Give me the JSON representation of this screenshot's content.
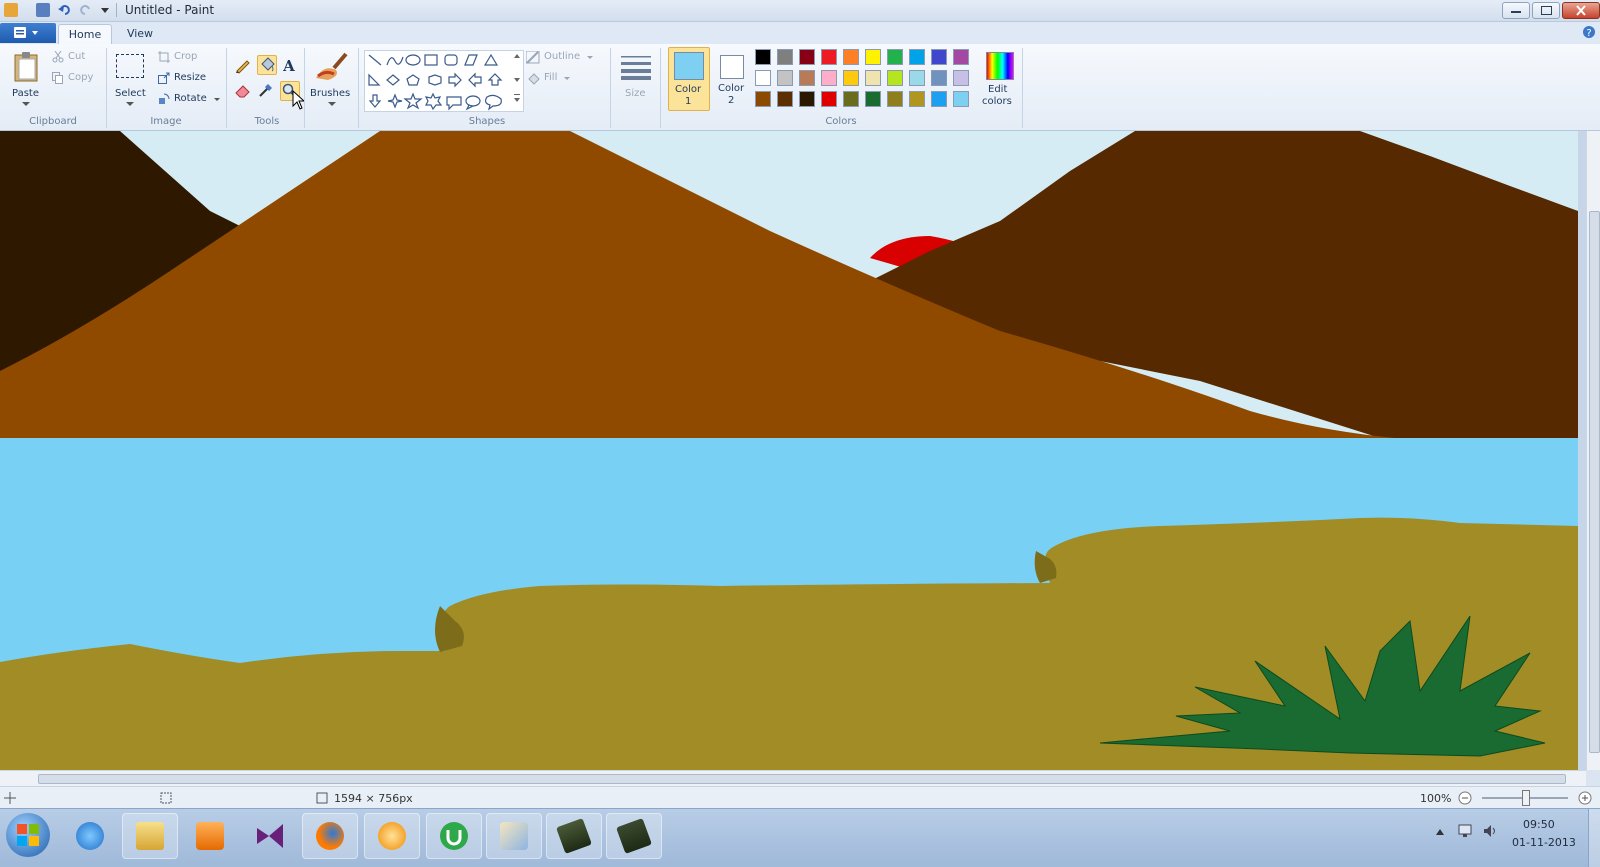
{
  "window": {
    "title": "Untitled - Paint"
  },
  "tabs": {
    "home": "Home",
    "view": "View"
  },
  "clipboard": {
    "paste": "Paste",
    "cut": "Cut",
    "copy": "Copy",
    "group": "Clipboard"
  },
  "image": {
    "select": "Select",
    "crop": "Crop",
    "resize": "Resize",
    "rotate": "Rotate",
    "group": "Image"
  },
  "tools": {
    "group": "Tools",
    "text_tool": "A"
  },
  "brushes": {
    "label": "Brushes"
  },
  "shapes": {
    "group": "Shapes",
    "outline": "Outline",
    "fill": "Fill"
  },
  "size": {
    "label": "Size"
  },
  "colors": {
    "color1_label": "Color",
    "color1_num": "1",
    "color2_label": "Color",
    "color2_num": "2",
    "group": "Colors",
    "edit_label": "Edit",
    "edit_label2": "colors",
    "color1_value": "#7ed0f2",
    "color2_value": "#ffffff",
    "palette": [
      [
        "#000000",
        "#7f7f7f",
        "#880015",
        "#ed1c24",
        "#ff7f27",
        "#fff200",
        "#22b14c",
        "#00a2e8",
        "#3f48cc",
        "#a349a4"
      ],
      [
        "#ffffff",
        "#c3c3c3",
        "#b97a57",
        "#ffaec9",
        "#ffc90e",
        "#efe4b0",
        "#b5e61d",
        "#99d9ea",
        "#7092be",
        "#c8bfe7"
      ],
      [
        "#8c4a00",
        "#5c2e00",
        "#2b1800",
        "#e00000",
        "#6b6b1e",
        "#1a6b32",
        "#8f7e1e",
        "#b0961e",
        "#1ea0f0",
        "#7ed0f2"
      ]
    ]
  },
  "status": {
    "dimensions": "1594 × 756px",
    "zoom": "100%"
  },
  "taskbar": {
    "time": "09:50",
    "date": "01-11-2013"
  }
}
